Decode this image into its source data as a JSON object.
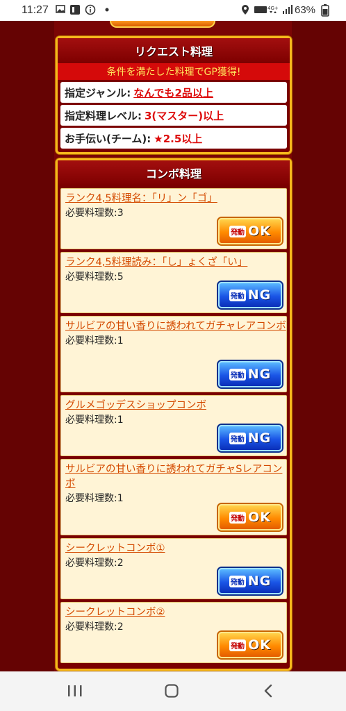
{
  "status_bar": {
    "time": "11:27",
    "battery": "63%",
    "icons": [
      "gallery-icon",
      "screenshot-icon",
      "info-icon",
      "dot-icon",
      "location-icon",
      "volte-icon",
      "signal-icon"
    ]
  },
  "request_panel": {
    "title": "リクエスト料理",
    "banner": "条件を満たした料理でGP獲得!",
    "rows": [
      {
        "label": "指定ジャンル:",
        "value": "なんでも2品以上"
      },
      {
        "label": "指定料理レベル:",
        "value": "3(マスター)以上"
      },
      {
        "label": "お手伝い(チーム):",
        "star": "★",
        "value": "2.5以上"
      }
    ]
  },
  "combo_panel": {
    "title": "コンボ料理",
    "badge_prefix": "発動",
    "items": [
      {
        "name": "ランク4,5料理名：「リ」ン「ゴ」",
        "req_label": "必要料理数:",
        "req_value": "3",
        "status": "OK"
      },
      {
        "name": "ランク4,5料理読み：「し」ょくざ「い」",
        "req_label": "必要料理数:",
        "req_value": "5",
        "status": "NG"
      },
      {
        "name": "サルビアの甘い香りに誘われてガチャレアコンボ",
        "req_label": "必要料理数:",
        "req_value": "1",
        "status": "NG"
      },
      {
        "name": "グルメゴッデスショップコンボ",
        "req_label": "必要料理数:",
        "req_value": "1",
        "status": "NG"
      },
      {
        "name": "サルビアの甘い香りに誘われてガチャSレアコンボ",
        "req_label": "必要料理数:",
        "req_value": "1",
        "status": "OK"
      },
      {
        "name": "シークレットコンボ①",
        "req_label": "必要料理数:",
        "req_value": "2",
        "status": "NG"
      },
      {
        "name": "シークレットコンボ②",
        "req_label": "必要料理数:",
        "req_value": "2",
        "status": "OK"
      }
    ]
  },
  "colors": {
    "ok_orange": "#ff8a00",
    "ng_blue": "#1a55e6",
    "panel_gold": "#f6b81d",
    "accent_red": "#dd0a0a",
    "link_orange": "#d44a00"
  }
}
